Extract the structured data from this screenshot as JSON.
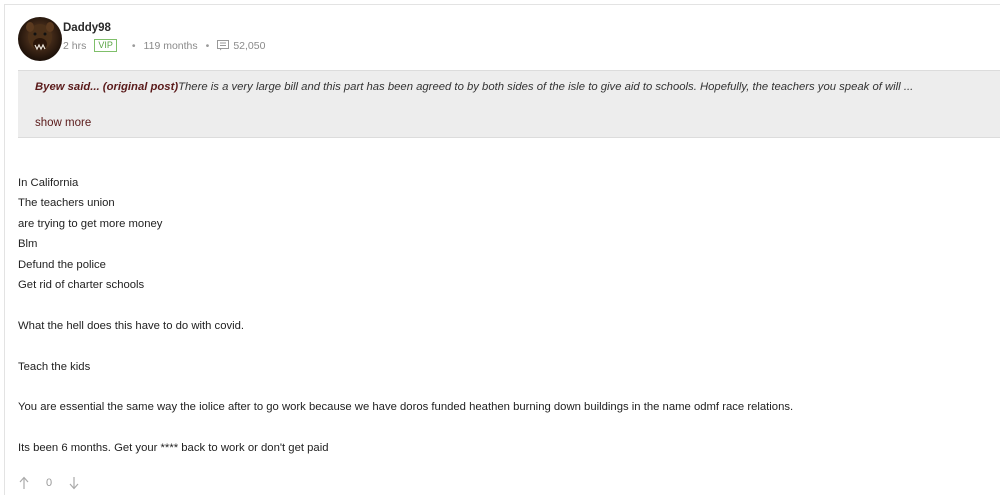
{
  "post": {
    "username": "Daddy98",
    "time_ago": "2 hrs",
    "badge": "VIP",
    "membership": "119 months",
    "post_count": "52,050"
  },
  "quote": {
    "author_label": "Byew said... (original post)",
    "text": "There is a very large bill and this part has been agreed to by both sides of the isle to give aid to schools. Hopefully, the teachers you speak of will ...",
    "show_more": "show more"
  },
  "body": {
    "lines": [
      "In California",
      "The teachers union",
      "are trying to get more money",
      "Blm",
      "Defund the police",
      "Get rid of charter schools",
      "",
      "What the hell does this have to do with covid.",
      "",
      "Teach the kids",
      "",
      "You are essential the same way the iolice after to go work because we have doros funded heathen burning down buildings in the name odmf race relations.",
      "",
      "Its been 6 months. Get your **** back to work or don't get paid"
    ]
  },
  "votes": {
    "count": "0"
  },
  "colors": {
    "vip": "#5aa545",
    "quote_bg": "#ededed",
    "link": "#5a1a1a"
  },
  "icons": [
    "avatar",
    "comment-icon",
    "upvote-icon",
    "downvote-icon"
  ]
}
